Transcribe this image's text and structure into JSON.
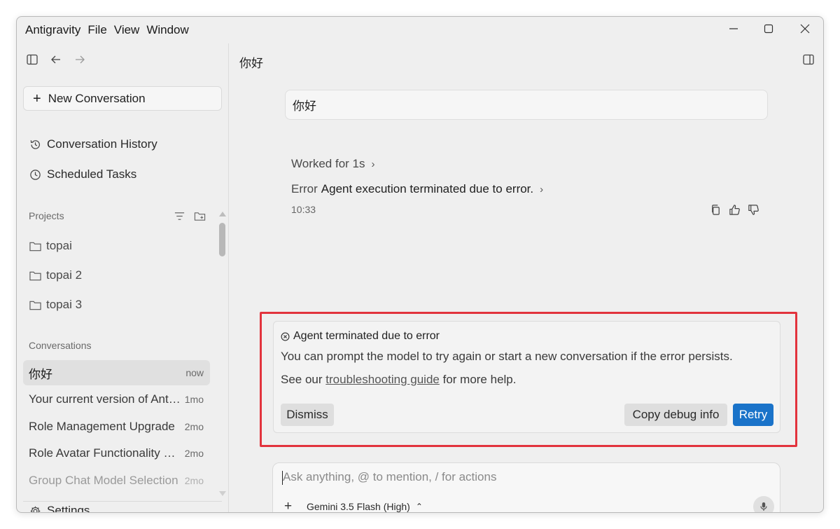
{
  "menu": [
    "Antigravity",
    "File",
    "View",
    "Window"
  ],
  "sidebar": {
    "new_conversation": "New Conversation",
    "conversation_history": "Conversation History",
    "scheduled_tasks": "Scheduled Tasks",
    "projects_label": "Projects",
    "projects": [
      "topai",
      "topai 2",
      "topai 3"
    ],
    "conversations_label": "Conversations",
    "conversations": [
      {
        "title": "你好",
        "ago": "now"
      },
      {
        "title": "Your current version of Antigravity is out of date",
        "ago": "1mo"
      },
      {
        "title": "Role Management Upgrade",
        "ago": "2mo"
      },
      {
        "title": "Role Avatar Functionality Update",
        "ago": "2mo"
      },
      {
        "title": "Group Chat Model Selection",
        "ago": "2mo"
      }
    ],
    "settings": "Settings"
  },
  "main": {
    "title": "你好",
    "user_message": "你好",
    "worked_for": "Worked for 1s",
    "error_prefix": "Error",
    "error_text": "Agent execution terminated due to error.",
    "timestamp": "10:33"
  },
  "error_card": {
    "title": "Agent terminated due to error",
    "body": "You can prompt the model to try again or start a new conversation if the error persists.",
    "help_prefix": "See our",
    "help_link": "troubleshooting guide",
    "help_suffix": "for more help.",
    "dismiss": "Dismiss",
    "copy_debug": "Copy debug info",
    "retry": "Retry"
  },
  "composer": {
    "placeholder": "Ask anything, @ to mention, / for actions",
    "model": "Gemini 3.5 Flash (High)"
  },
  "colors": {
    "accent": "#1a73c9",
    "highlight": "#e2333d"
  }
}
